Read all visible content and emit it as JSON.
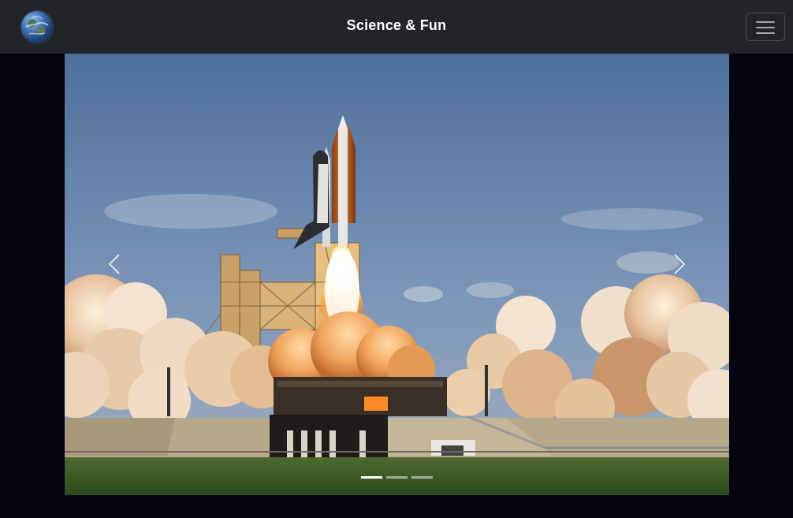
{
  "navbar": {
    "brand_title": "Science & Fun",
    "logo_icon": "earth-globe-icon",
    "toggler_icon": "hamburger-menu-icon",
    "background": "#212529"
  },
  "carousel": {
    "slide_subject": "space shuttle launch",
    "prev_icon": "chevron-left-icon",
    "next_icon": "chevron-right-icon",
    "slide_count": 3,
    "active_slide": 1
  },
  "colors": {
    "page_background": "#02040f",
    "brand_text": "#ffffff"
  }
}
